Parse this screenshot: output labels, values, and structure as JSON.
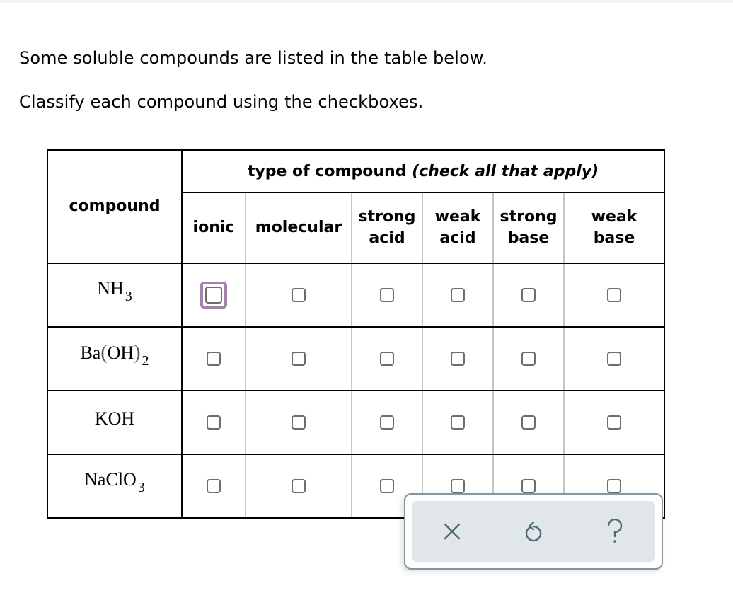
{
  "prompt": {
    "line1": "Some soluble compounds are listed in the table below.",
    "line2": "Classify each compound using the checkboxes."
  },
  "table": {
    "compound_header": "compound",
    "type_header": "type of compound ",
    "type_header_note": "(check all that apply)",
    "columns": [
      {
        "line1": "ionic",
        "line2": ""
      },
      {
        "line1": "molecular",
        "line2": ""
      },
      {
        "line1": "strong",
        "line2": "acid"
      },
      {
        "line1": "weak",
        "line2": "acid"
      },
      {
        "line1": "strong",
        "line2": "base"
      },
      {
        "line1": "weak",
        "line2": "base"
      }
    ],
    "rows": [
      {
        "formula_main": "NH",
        "formula_sub": "3",
        "checked": [
          false,
          false,
          false,
          false,
          false,
          false
        ]
      },
      {
        "formula_main": "Ba",
        "paren_open": "(",
        "formula_mid": "OH",
        "paren_close": ")",
        "formula_sub": "2",
        "checked": [
          false,
          false,
          false,
          false,
          false,
          false
        ]
      },
      {
        "formula_main": "KOH",
        "formula_sub": "",
        "checked": [
          false,
          false,
          false,
          false,
          false,
          false
        ]
      },
      {
        "formula_main": "NaClO",
        "formula_sub": "3",
        "checked": [
          false,
          false,
          false,
          false,
          false,
          false
        ]
      }
    ],
    "focused_checkbox": {
      "row": 0,
      "column": "ionic"
    }
  },
  "actions": {
    "clear": {
      "icon": "x-icon",
      "label": "Clear"
    },
    "undo": {
      "icon": "undo-icon",
      "label": "Undo"
    },
    "help": {
      "icon": "help-icon",
      "label": "Help"
    }
  },
  "colors": {
    "focus_ring": "#a97fb3",
    "checkbox_border": "#6d6d6d",
    "action_bg": "#e1e6e9",
    "action_border": "#8197a2",
    "action_icon": "#4e6b78"
  }
}
